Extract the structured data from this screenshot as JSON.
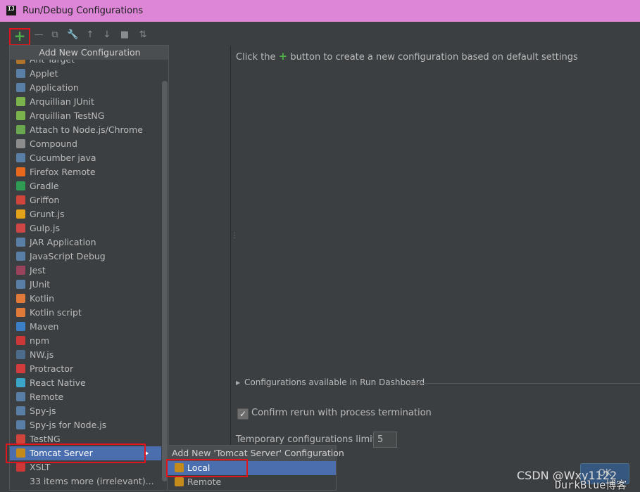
{
  "window": {
    "title": "Run/Debug Configurations",
    "app_icon": "IJ"
  },
  "toolbar": {
    "add": "+",
    "buttons": [
      "add-icon",
      "remove-icon",
      "copy-icon",
      "wrench-icon",
      "move-up-icon",
      "move-down-icon",
      "folder-icon",
      "sort-icon"
    ]
  },
  "popup": {
    "header": "Add New Configuration",
    "partial_first_item": "Ant Target",
    "items": [
      {
        "label": "Applet",
        "icon": "applet-icon",
        "color": "#5a7fa6"
      },
      {
        "label": "Application",
        "icon": "application-icon",
        "color": "#5a7fa6"
      },
      {
        "label": "Arquillian JUnit",
        "icon": "arquillian-icon",
        "color": "#7ab24c"
      },
      {
        "label": "Arquillian TestNG",
        "icon": "arquillian-icon",
        "color": "#7ab24c"
      },
      {
        "label": "Attach to Node.js/Chrome",
        "icon": "nodejs-icon",
        "color": "#6aa84f"
      },
      {
        "label": "Compound",
        "icon": "compound-icon",
        "color": "#8c8c8c"
      },
      {
        "label": "Cucumber java",
        "icon": "cucumber-icon",
        "color": "#5a7fa6"
      },
      {
        "label": "Firefox Remote",
        "icon": "firefox-icon",
        "color": "#e8691e"
      },
      {
        "label": "Gradle",
        "icon": "gradle-icon",
        "color": "#2f9c53"
      },
      {
        "label": "Griffon",
        "icon": "griffon-icon",
        "color": "#d0453b"
      },
      {
        "label": "Grunt.js",
        "icon": "grunt-icon",
        "color": "#e3a21a"
      },
      {
        "label": "Gulp.js",
        "icon": "gulp-icon",
        "color": "#cf4647"
      },
      {
        "label": "JAR Application",
        "icon": "jar-icon",
        "color": "#5a7fa6"
      },
      {
        "label": "JavaScript Debug",
        "icon": "js-debug-icon",
        "color": "#5a7fa6"
      },
      {
        "label": "Jest",
        "icon": "jest-icon",
        "color": "#99425b"
      },
      {
        "label": "JUnit",
        "icon": "junit-icon",
        "color": "#5a7fa6"
      },
      {
        "label": "Kotlin",
        "icon": "kotlin-icon",
        "color": "#e07a3b"
      },
      {
        "label": "Kotlin script",
        "icon": "kotlin-icon",
        "color": "#e07a3b"
      },
      {
        "label": "Maven",
        "icon": "maven-icon",
        "color": "#3d7fc6"
      },
      {
        "label": "npm",
        "icon": "npm-icon",
        "color": "#cb3837"
      },
      {
        "label": "NW.js",
        "icon": "nwjs-icon",
        "color": "#4d6b8a"
      },
      {
        "label": "Protractor",
        "icon": "protractor-icon",
        "color": "#d33c3c"
      },
      {
        "label": "React Native",
        "icon": "react-icon",
        "color": "#3ba4c9"
      },
      {
        "label": "Remote",
        "icon": "remote-icon",
        "color": "#5a7fa6"
      },
      {
        "label": "Spy-js",
        "icon": "spyjs-icon",
        "color": "#5a7fa6"
      },
      {
        "label": "Spy-js for Node.js",
        "icon": "spyjs-icon",
        "color": "#5a7fa6"
      },
      {
        "label": "TestNG",
        "icon": "testng-icon",
        "color": "#d0453b"
      },
      {
        "label": "Tomcat Server",
        "icon": "tomcat-icon",
        "color": "#c48a1a",
        "selected": true,
        "has_submenu": true
      },
      {
        "label": "XSLT",
        "icon": "xslt-icon",
        "color": "#cb3837"
      },
      {
        "label": "33 items more (irrelevant)...",
        "icon": "",
        "color": ""
      }
    ]
  },
  "submenu": {
    "header": "Add New 'Tomcat Server' Configuration",
    "items": [
      {
        "label": "Local",
        "selected": true
      },
      {
        "label": "Remote",
        "selected": false
      }
    ]
  },
  "right": {
    "hint_prefix": "Click the",
    "hint_suffix": "button to create a new configuration based on default settings",
    "dashboard": "Configurations available in Run Dashboard",
    "confirm_label": "Confirm rerun with process termination",
    "confirm_checked": true,
    "limit_label": "Temporary configurations limit:",
    "limit_value": "5",
    "ok_label": "OK"
  },
  "watermark": {
    "csdn": "CSDN @Wxy1122",
    "blog": "DurkBlue博客"
  }
}
